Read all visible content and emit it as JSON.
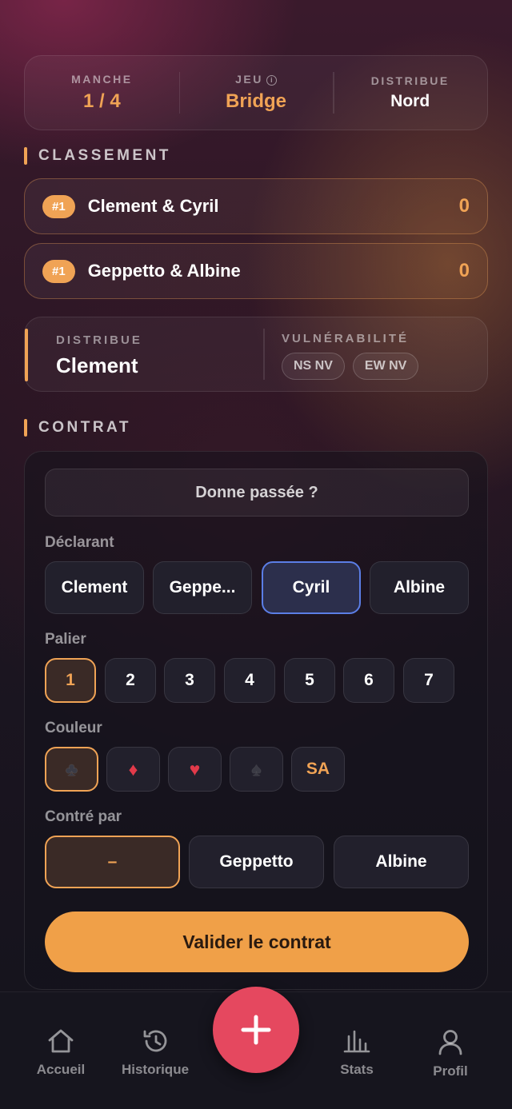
{
  "header": {
    "manche": {
      "label": "MANCHE",
      "value": "1 / 4"
    },
    "jeu": {
      "label": "JEU",
      "value": "Bridge"
    },
    "distribue": {
      "label": "DISTRIBUE",
      "value": "Nord"
    }
  },
  "classement": {
    "title": "CLASSEMENT",
    "teams": [
      {
        "rank": "#1",
        "name": "Clement & Cyril",
        "score": "0"
      },
      {
        "rank": "#1",
        "name": "Geppetto & Albine",
        "score": "0"
      }
    ]
  },
  "dealer": {
    "label": "DISTRIBUE",
    "name": "Clement",
    "vul_label": "VULNÉRABILITÉ",
    "vul": [
      "NS NV",
      "EW NV"
    ]
  },
  "contrat": {
    "title": "CONTRAT",
    "pass_label": "Donne passée ?",
    "declarant_label": "Déclarant",
    "declarants": [
      "Clement",
      "Geppe...",
      "Cyril",
      "Albine"
    ],
    "selected_declarant": "Cyril",
    "palier_label": "Palier",
    "paliers": [
      "1",
      "2",
      "3",
      "4",
      "5",
      "6",
      "7"
    ],
    "selected_palier": "1",
    "couleur_label": "Couleur",
    "couleurs": [
      "♣",
      "♦",
      "♥",
      "♠",
      "SA"
    ],
    "selected_couleur": "♣",
    "contre_label": "Contré par",
    "contre_options": [
      "–",
      "Geppetto",
      "Albine"
    ],
    "selected_contre": "–",
    "validate_label": "Valider le contrat"
  },
  "nav": {
    "items": [
      {
        "label": "Accueil",
        "icon": "home-icon"
      },
      {
        "label": "Historique",
        "icon": "history-icon"
      },
      {
        "label": "Stats",
        "icon": "stats-icon"
      },
      {
        "label": "Profil",
        "icon": "profile-icon"
      }
    ],
    "fab_icon": "plus-icon"
  },
  "colors": {
    "accent": "#f0a355",
    "fab": "#e5485f",
    "selected_blue": "#5b7ee6",
    "diamond": "#e23a4a",
    "heart": "#e23a4a"
  }
}
